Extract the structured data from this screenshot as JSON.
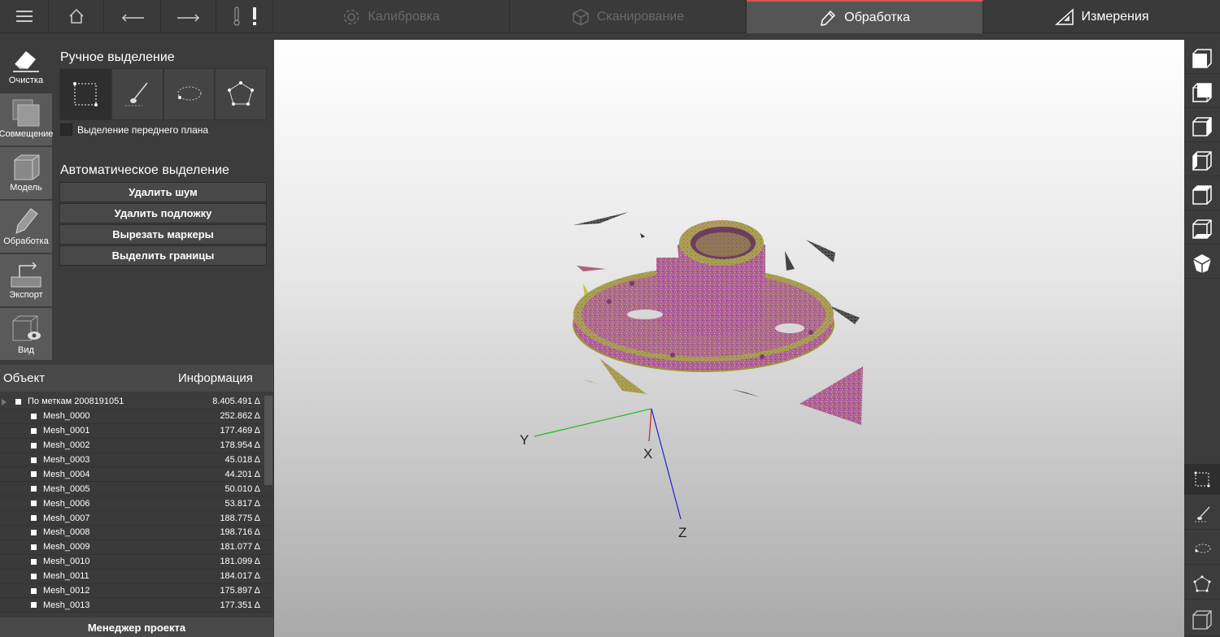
{
  "topbar": {
    "tabs": [
      {
        "label": "Калибровка",
        "state": "disabled"
      },
      {
        "label": "Сканирование",
        "state": "disabled"
      },
      {
        "label": "Обработка",
        "state": "active"
      },
      {
        "label": "Измерения",
        "state": "normal"
      }
    ],
    "icons": [
      "menu-icon",
      "home-icon",
      "undo-icon",
      "redo-icon",
      "thermometer-icon",
      "exclamation-icon"
    ],
    "accent": "#e05050"
  },
  "modes": [
    {
      "label": "Очистка",
      "icon": "eraser-icon"
    },
    {
      "label": "Совмещение",
      "icon": "align-icon"
    },
    {
      "label": "Модель",
      "icon": "model-cube-icon"
    },
    {
      "label": "Обработка",
      "icon": "pencil-icon"
    },
    {
      "label": "Экспорт",
      "icon": "export-icon"
    },
    {
      "label": "Вид",
      "icon": "view-eye-icon"
    }
  ],
  "tools": {
    "manual_title": "Ручное выделение",
    "foreground_label": "Выделение переднего плана",
    "auto_title": "Автоматическое выделение",
    "buttons": [
      "Удалить шум",
      "Удалить подложку",
      "Вырезать маркеры",
      "Выделить границы"
    ]
  },
  "objects": {
    "header_object": "Объект",
    "header_info": "Информация",
    "root": {
      "name": "По меткам 2008191051",
      "value": "8.405.491 Δ"
    },
    "items": [
      {
        "name": "Mesh_0000",
        "value": "252.862 Δ"
      },
      {
        "name": "Mesh_0001",
        "value": "177.469 Δ"
      },
      {
        "name": "Mesh_0002",
        "value": "178.954 Δ"
      },
      {
        "name": "Mesh_0003",
        "value": "45.018 Δ"
      },
      {
        "name": "Mesh_0004",
        "value": "44.201 Δ"
      },
      {
        "name": "Mesh_0005",
        "value": "50.010 Δ"
      },
      {
        "name": "Mesh_0006",
        "value": "53.817 Δ"
      },
      {
        "name": "Mesh_0007",
        "value": "188.775 Δ"
      },
      {
        "name": "Mesh_0008",
        "value": "198.716 Δ"
      },
      {
        "name": "Mesh_0009",
        "value": "181.077 Δ"
      },
      {
        "name": "Mesh_0010",
        "value": "181.099 Δ"
      },
      {
        "name": "Mesh_0011",
        "value": "184.017 Δ"
      },
      {
        "name": "Mesh_0012",
        "value": "175.897 Δ"
      },
      {
        "name": "Mesh_0013",
        "value": "177.351 Δ"
      }
    ],
    "project_manager": "Менеджер проекта"
  },
  "viewport": {
    "axis_x": "X",
    "axis_y": "Y",
    "axis_z": "Z",
    "colors": {
      "x": "#cc2222",
      "y": "#22bb22",
      "z": "#2222cc",
      "mesh_pink": "#b0609a",
      "mesh_yellow": "#b6b04a"
    }
  }
}
